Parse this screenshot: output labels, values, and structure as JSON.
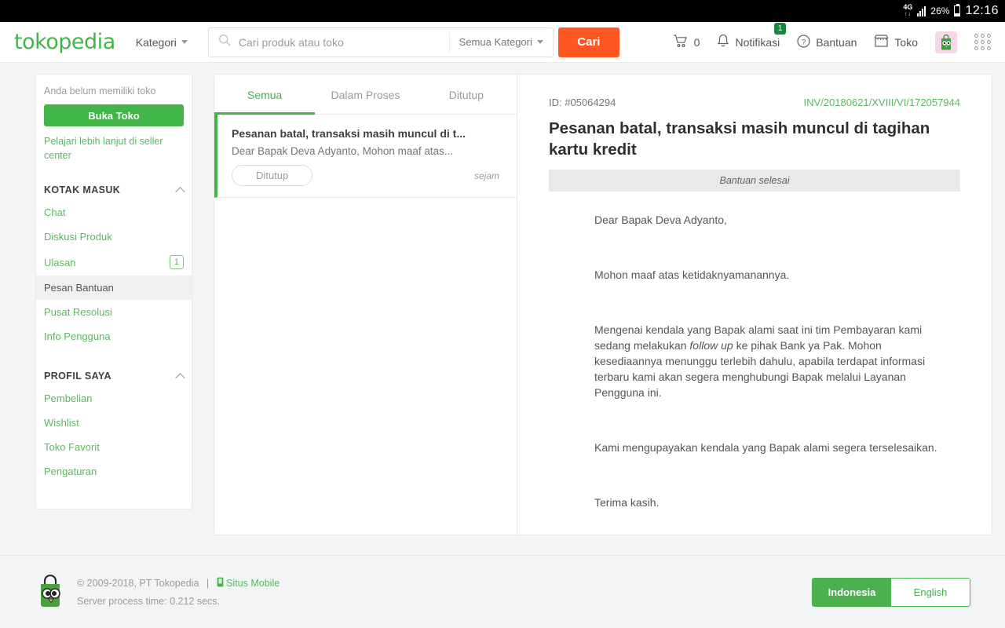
{
  "statusbar": {
    "network": "4G",
    "battery_pct": "26%",
    "time": "12:16"
  },
  "header": {
    "logo": "tokopedia",
    "kategori": "Kategori",
    "search_placeholder": "Cari produk atau toko",
    "search_value": "",
    "search_category": "Semua Kategori",
    "search_button": "Cari",
    "cart_count": "0",
    "notif_label": "Notifikasi",
    "notif_badge": "1",
    "bantuan_label": "Bantuan",
    "toko_label": "Toko"
  },
  "sidebar": {
    "no_shop_note": "Anda belum memiliki toko",
    "open_shop_button": "Buka Toko",
    "seller_center_link": "Pelajari lebih lanjut di seller center",
    "sections": [
      {
        "title": "KOTAK MASUK",
        "items": [
          {
            "label": "Chat",
            "badge": "",
            "active": false
          },
          {
            "label": "Diskusi Produk",
            "badge": "",
            "active": false
          },
          {
            "label": "Ulasan",
            "badge": "1",
            "active": false
          },
          {
            "label": "Pesan Bantuan",
            "badge": "",
            "active": true
          },
          {
            "label": "Pusat Resolusi",
            "badge": "",
            "active": false
          },
          {
            "label": "Info Pengguna",
            "badge": "",
            "active": false
          }
        ]
      },
      {
        "title": "PROFIL SAYA",
        "items": [
          {
            "label": "Pembelian",
            "badge": "",
            "active": false
          },
          {
            "label": "Wishlist",
            "badge": "",
            "active": false
          },
          {
            "label": "Toko Favorit",
            "badge": "",
            "active": false
          },
          {
            "label": "Pengaturan",
            "badge": "",
            "active": false
          }
        ]
      }
    ]
  },
  "inbox": {
    "tabs": [
      {
        "label": "Semua",
        "active": true
      },
      {
        "label": "Dalam Proses",
        "active": false
      },
      {
        "label": "Ditutup",
        "active": false
      }
    ],
    "items": [
      {
        "title": "Pesanan batal, transaksi masih muncul di t...",
        "preview": "Dear Bapak Deva Adyanto, Mohon maaf atas...",
        "status": "Ditutup",
        "time": "sejam"
      }
    ]
  },
  "detail": {
    "id_label": "ID: #05064294",
    "invoice": "INV/20180621/XVIII/VI/172057944",
    "title": "Pesanan batal, transaksi masih muncul di tagihan kartu kredit",
    "status": "Bantuan selesai",
    "paragraphs": [
      "Dear Bapak Deva Adyanto,",
      "Mohon maaf atas ketidaknyamanannya.",
      "Mengenai kendala yang Bapak alami saat ini tim Pembayaran kami sedang melakukan follow up ke pihak Bank ya Pak. Mohon kesediaannya menunggu terlebih dahulu, apabila terdapat informasi terbaru kami akan segera menghubungi Bapak melalui Layanan Pengguna ini.",
      "Kami mengupayakan kendala yang Bapak alami segera terselesaikan.",
      "Terima kasih."
    ],
    "italic_phrase": "follow up"
  },
  "footer": {
    "copyright": "© 2009-2018, PT Tokopedia",
    "separator": "|",
    "mobile_site": "Situs Mobile",
    "server_time": "Server process time: 0.212 secs.",
    "lang_id": "Indonesia",
    "lang_en": "English"
  },
  "colors": {
    "brand_green": "#42b549",
    "accent_orange": "#ff5722",
    "link_green": "#5bb85f",
    "badge_green": "#17883c"
  }
}
